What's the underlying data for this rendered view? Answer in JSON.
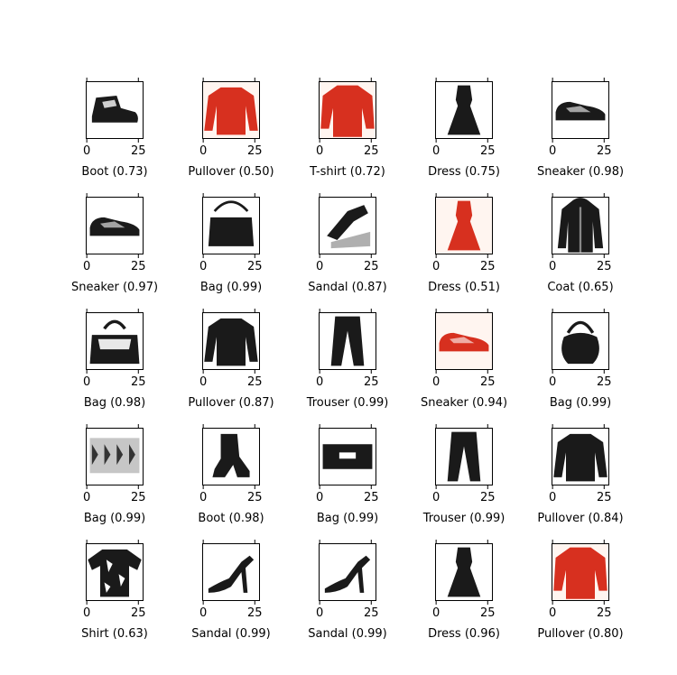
{
  "chart_data": {
    "type": "image-grid",
    "rows": 5,
    "cols": 5,
    "x_ticks": [
      0,
      25
    ],
    "x_tick_labels": [
      "0",
      "25"
    ],
    "palette": {
      "correct": "#000000",
      "incorrect": "#d7301f",
      "incorrect_bg": "#fff5f0"
    },
    "images": [
      {
        "label": "Boot (0.73)",
        "class": "Boot",
        "confidence": 0.73,
        "correct": true,
        "icon": "boot-icon"
      },
      {
        "label": "Pullover (0.50)",
        "class": "Pullover",
        "confidence": 0.5,
        "correct": false,
        "icon": "cardigan-icon"
      },
      {
        "label": "T-shirt (0.72)",
        "class": "T-shirt",
        "confidence": 0.72,
        "correct": false,
        "icon": "blouse-icon"
      },
      {
        "label": "Dress (0.75)",
        "class": "Dress",
        "confidence": 0.75,
        "correct": true,
        "icon": "dress-icon"
      },
      {
        "label": "Sneaker (0.98)",
        "class": "Sneaker",
        "confidence": 0.98,
        "correct": true,
        "icon": "sneaker-icon"
      },
      {
        "label": "Sneaker (0.97)",
        "class": "Sneaker",
        "confidence": 0.97,
        "correct": true,
        "icon": "sneaker-icon"
      },
      {
        "label": "Bag (0.99)",
        "class": "Bag",
        "confidence": 0.99,
        "correct": true,
        "icon": "tote-bag-icon"
      },
      {
        "label": "Sandal (0.87)",
        "class": "Sandal",
        "confidence": 0.87,
        "correct": true,
        "icon": "sandal-icon"
      },
      {
        "label": "Dress (0.51)",
        "class": "Dress",
        "confidence": 0.51,
        "correct": false,
        "icon": "dress-icon"
      },
      {
        "label": "Coat (0.65)",
        "class": "Coat",
        "confidence": 0.65,
        "correct": true,
        "icon": "coat-icon"
      },
      {
        "label": "Bag (0.98)",
        "class": "Bag",
        "confidence": 0.98,
        "correct": true,
        "icon": "handbag-icon"
      },
      {
        "label": "Pullover (0.87)",
        "class": "Pullover",
        "confidence": 0.87,
        "correct": true,
        "icon": "pullover-icon"
      },
      {
        "label": "Trouser (0.99)",
        "class": "Trouser",
        "confidence": 0.99,
        "correct": true,
        "icon": "trouser-icon"
      },
      {
        "label": "Sneaker (0.94)",
        "class": "Sneaker",
        "confidence": 0.94,
        "correct": false,
        "icon": "sneaker-icon"
      },
      {
        "label": "Bag (0.99)",
        "class": "Bag",
        "confidence": 0.99,
        "correct": true,
        "icon": "hobo-bag-icon"
      },
      {
        "label": "Bag (0.99)",
        "class": "Bag",
        "confidence": 0.99,
        "correct": true,
        "icon": "pattern-bag-icon"
      },
      {
        "label": "Boot (0.98)",
        "class": "Boot",
        "confidence": 0.98,
        "correct": true,
        "icon": "ankle-boot-icon"
      },
      {
        "label": "Bag (0.99)",
        "class": "Bag",
        "confidence": 0.99,
        "correct": true,
        "icon": "clutch-icon"
      },
      {
        "label": "Trouser (0.99)",
        "class": "Trouser",
        "confidence": 0.99,
        "correct": true,
        "icon": "trouser-icon"
      },
      {
        "label": "Pullover (0.84)",
        "class": "Pullover",
        "confidence": 0.84,
        "correct": true,
        "icon": "pullover-icon"
      },
      {
        "label": "Shirt (0.63)",
        "class": "Shirt",
        "confidence": 0.63,
        "correct": true,
        "icon": "shirt-icon"
      },
      {
        "label": "Sandal (0.99)",
        "class": "Sandal",
        "confidence": 0.99,
        "correct": true,
        "icon": "heeled-sandal-icon"
      },
      {
        "label": "Sandal (0.99)",
        "class": "Sandal",
        "confidence": 0.99,
        "correct": true,
        "icon": "heeled-sandal-icon"
      },
      {
        "label": "Dress (0.96)",
        "class": "Dress",
        "confidence": 0.96,
        "correct": true,
        "icon": "dress-icon"
      },
      {
        "label": "Pullover (0.80)",
        "class": "Pullover",
        "confidence": 0.8,
        "correct": false,
        "icon": "blouse-icon"
      }
    ]
  }
}
